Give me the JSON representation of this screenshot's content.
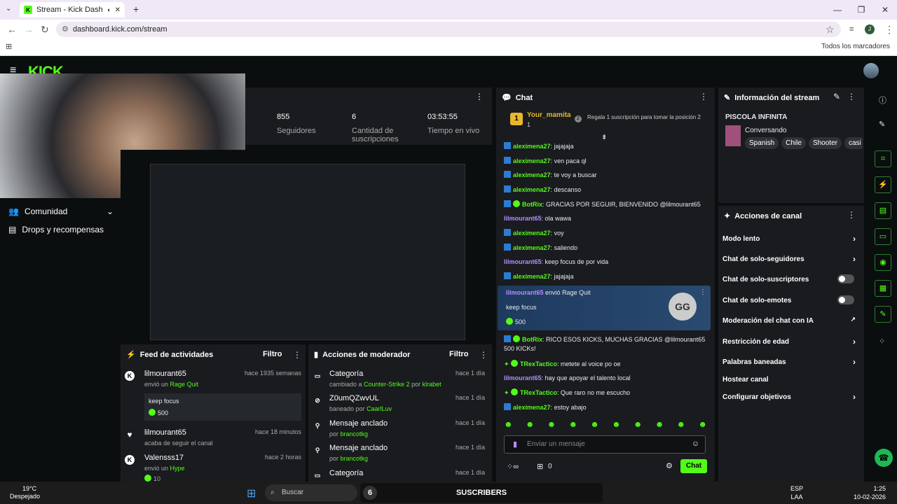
{
  "browser": {
    "tab_title": "Stream - Kick Dashboard",
    "url": "dashboard.kick.com/stream",
    "bookmarks_label": "Todos los marcadores"
  },
  "header": {
    "logo": "KICK"
  },
  "sidebar": {
    "items": [
      {
        "label": "Comunidad"
      },
      {
        "label": "Drops y recompensas"
      }
    ]
  },
  "stats": [
    {
      "value": "855",
      "label": "Seguidores"
    },
    {
      "value": "6",
      "label": "Cantidad de suscripciones"
    },
    {
      "value": "03:53:55",
      "label": "Tiempo en vivo"
    }
  ],
  "feed": {
    "title": "Feed de actividades",
    "filter": "Filtro",
    "items": [
      {
        "user": "lilmourant65",
        "time": "hace 1935 semanas",
        "action": "envió un",
        "target": "Rage Quit",
        "message": "keep focus",
        "amount": "500"
      },
      {
        "user": "lilmourant65",
        "time": "hace 18 minutos",
        "action": "acaba de seguir el canal"
      },
      {
        "user": "Valensss17",
        "time": "hace 2 horas",
        "action": "envió un",
        "target": "Hype",
        "amount": "10"
      }
    ]
  },
  "mod": {
    "title": "Acciones de moderador",
    "filter": "Filtro",
    "items": [
      {
        "title": "Categoría",
        "time": "hace 1 día",
        "detail": "cambiado a",
        "hl": "Counter-Strike 2",
        "by": "por",
        "user": "klrabet"
      },
      {
        "title": "Z0umQZwvUL",
        "time": "hace 1 día",
        "detail": "baneado por",
        "hl": "CaarlLuv",
        "by": "",
        "user": ""
      },
      {
        "title": "Mensaje anclado",
        "time": "hace 1 día",
        "detail": "por",
        "hl": "brancotkg",
        "by": "",
        "user": ""
      },
      {
        "title": "Mensaje anclado",
        "time": "hace 1 día",
        "detail": "por",
        "hl": "brancotkg",
        "by": "",
        "user": ""
      },
      {
        "title": "Categoría",
        "time": "hace 1 día"
      }
    ]
  },
  "chat": {
    "title": "Chat",
    "pinned_user": "Your_mamita",
    "pinned_count": "1",
    "pinned_rank": "2",
    "pinned_note": "Regala 1 suscripción para tomar la posición 2",
    "messages": [
      {
        "user": "aleximena27",
        "text": "jajajaja",
        "color": "#53fc18"
      },
      {
        "user": "aleximena27",
        "text": "ven paca ql",
        "color": "#53fc18"
      },
      {
        "user": "aleximena27",
        "text": "te voy a buscar",
        "color": "#53fc18"
      },
      {
        "user": "aleximena27",
        "text": "descanso",
        "color": "#53fc18"
      },
      {
        "user": "BotRix",
        "text": "GRACIAS POR SEGUIR, BIENVENIDO @lilmourant65",
        "color": "#53fc18"
      },
      {
        "user": "lilmourant65",
        "text": "ola wawa",
        "color": "#b48cff"
      },
      {
        "user": "aleximena27",
        "text": "voy",
        "color": "#53fc18"
      },
      {
        "user": "aleximena27",
        "text": "saliendo",
        "color": "#53fc18"
      },
      {
        "user": "lilmourant65",
        "text": "keep focus de por vida",
        "color": "#b48cff"
      },
      {
        "user": "aleximena27",
        "text": "jajajaja",
        "color": "#53fc18"
      }
    ],
    "gift": {
      "user": "lilmourant65",
      "verb": "envió",
      "item": "Rage Quit",
      "message": "keep focus",
      "amount": "500",
      "logo": "GG"
    },
    "messages2": [
      {
        "user": "BotRix",
        "text": "RICO ESOS KICKS, MUCHAS GRACIAS @lilmourant65",
        "text2": "500 KICKs!",
        "color": "#53fc18"
      },
      {
        "user": "TRexTactico",
        "text": "metete al voice po oe",
        "color": "#53fc18"
      },
      {
        "user": "lilmourant65",
        "text": "hay que apoyar el talento local",
        "color": "#b48cff"
      },
      {
        "user": "TRexTactico",
        "text": "Que raro no me escucho",
        "color": "#53fc18"
      },
      {
        "user": "aleximena27",
        "text": "estoy abajo",
        "color": "#53fc18"
      }
    ],
    "input_placeholder": "Enviar un mensaje",
    "points": "0",
    "send": "Chat"
  },
  "info": {
    "title": "Información del stream",
    "stream_title": "PISCOLA INFINITA",
    "category": "Conversando",
    "tags": [
      "Spanish",
      "Chile",
      "Shooter",
      "casi"
    ]
  },
  "actions": {
    "title": "Acciones de canal",
    "items": [
      {
        "label": "Modo lento",
        "kind": "chev"
      },
      {
        "label": "Chat de solo-seguidores",
        "kind": "chev"
      },
      {
        "label": "Chat de solo-suscriptores",
        "kind": "toggle"
      },
      {
        "label": "Chat de solo-emotes",
        "kind": "toggle"
      },
      {
        "label": "Moderación del chat con IA",
        "kind": "ext"
      },
      {
        "label": "Restricción de edad",
        "kind": "chev"
      },
      {
        "label": "Palabras baneadas",
        "kind": "chev"
      },
      {
        "label": "Hostear canal",
        "kind": "none"
      },
      {
        "label": "Configurar objetivos",
        "kind": "chev"
      }
    ]
  },
  "taskbar": {
    "temp": "19°C",
    "weather": "Despejado",
    "search": "Buscar",
    "banner": "SUSCRIBERS",
    "banner_num": "6",
    "lang": "ESP",
    "lang2": "LAA",
    "time": "1:25",
    "date": "10-02-2026"
  }
}
